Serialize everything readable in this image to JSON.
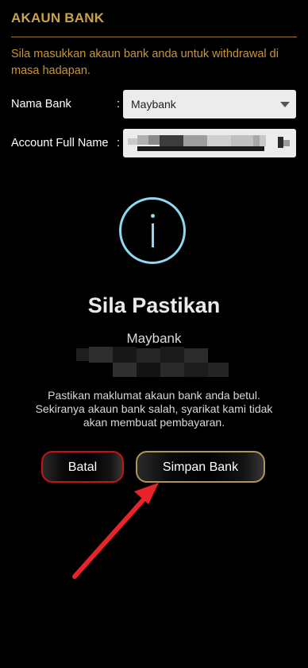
{
  "header": {
    "title": "AKAUN BANK"
  },
  "notice": "Sila masukkan akaun bank anda untuk withdrawal di masa hadapan.",
  "form": {
    "bank_label": "Nama Bank",
    "bank_colon": ":",
    "bank_value": "Maybank",
    "name_label": "Account Full Name",
    "name_colon": ":",
    "name_value_redacted": true
  },
  "dialog": {
    "icon": "info-icon",
    "title": "Sila Pastikan",
    "bank": "Maybank",
    "warning_line1": "Pastikan maklumat akaun bank anda betul.",
    "warning_line2": "Sekiranya akaun bank salah, syarikat kami tidak",
    "warning_line3": "akan membuat pembayaran.",
    "cancel_label": "Batal",
    "save_label": "Simpan Bank"
  },
  "annotation": {
    "icon": "red-arrow-icon"
  },
  "colors": {
    "background": "#000000",
    "accent_gold": "#c9a24a",
    "notice_gold": "#c9952c",
    "info_cyan": "#8fd8ef",
    "cancel_border": "#c41416",
    "save_border": "#b3925a",
    "arrow_red": "#e8232b"
  }
}
